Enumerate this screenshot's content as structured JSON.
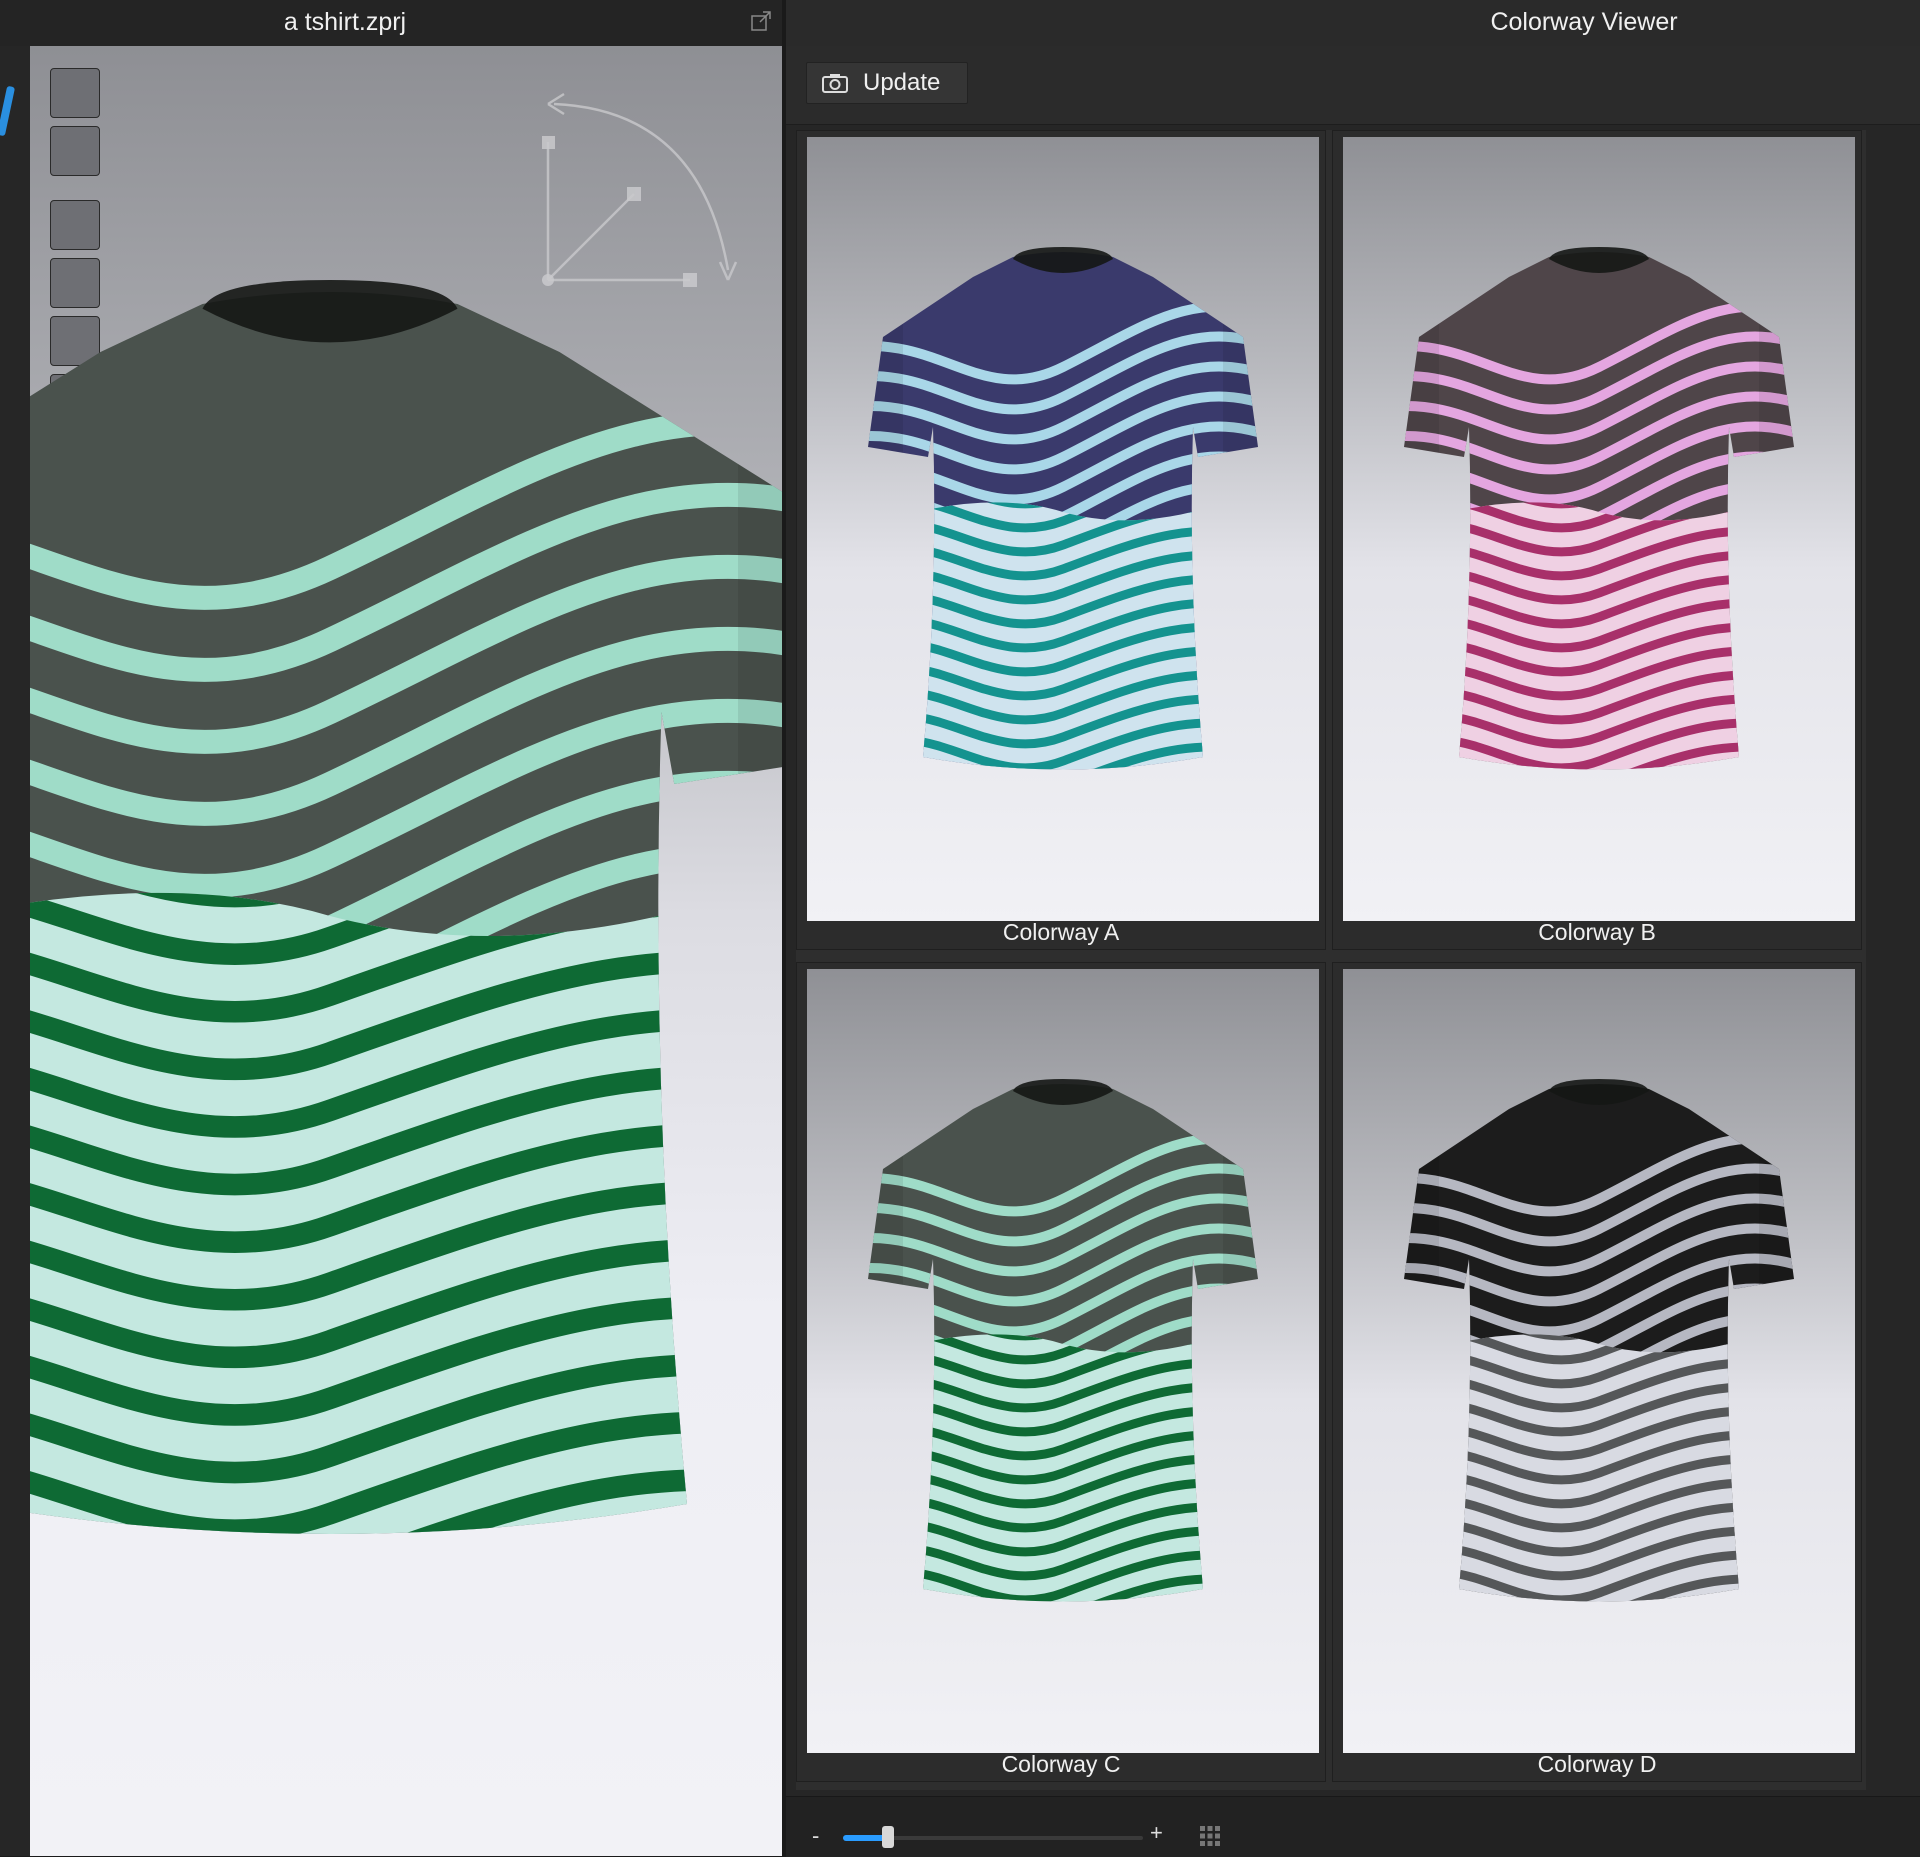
{
  "left_panel": {
    "title": "a tshirt.zprj",
    "main_colors": {
      "yoke": "#4a524d",
      "stripe_top": "#9fdcc8",
      "body": "#c4e8e0",
      "stripe_body": "#0e6a34"
    }
  },
  "colorway_viewer": {
    "title": "Colorway Viewer",
    "update_label": "Update",
    "zoom_minus": "-",
    "zoom_plus": "+",
    "zoom_level": 0.15,
    "colorways": [
      {
        "name": "Colorway A",
        "yoke": "#3a3a6c",
        "stripe_top": "#a9d7e8",
        "body": "#cfe3ee",
        "stripe_body": "#14938f"
      },
      {
        "name": "Colorway B",
        "yoke": "#4f4549",
        "stripe_top": "#e4a6e0",
        "body": "#efd0e3",
        "stripe_body": "#a8306a"
      },
      {
        "name": "Colorway C",
        "yoke": "#4a524d",
        "stripe_top": "#9fdcc8",
        "body": "#c4e8e0",
        "stripe_body": "#0e6a34"
      },
      {
        "name": "Colorway D",
        "yoke": "#1c1c1c",
        "stripe_top": "#b6b8c2",
        "body": "#d8dae2",
        "stripe_body": "#555759"
      }
    ]
  },
  "icons": [
    "popout-icon",
    "camera-icon",
    "grid-view-icon",
    "gizmo-icon"
  ]
}
